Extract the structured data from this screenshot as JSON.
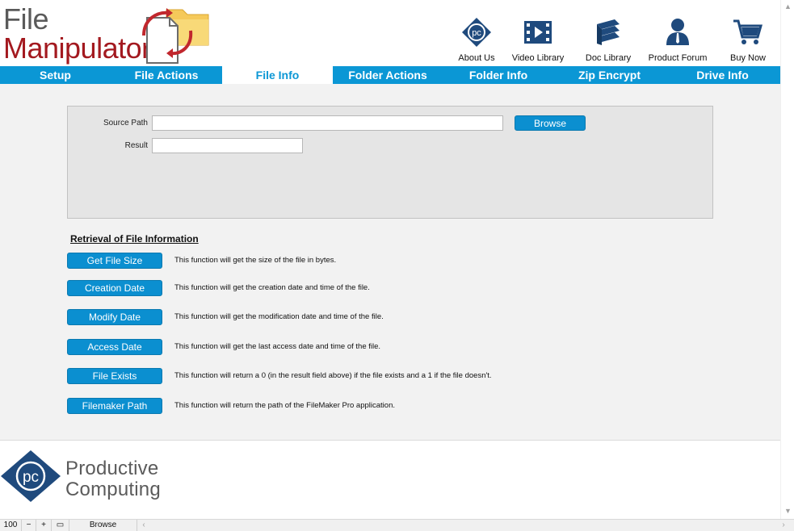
{
  "header": {
    "logo_line1": "File",
    "logo_line2": "Manipulator"
  },
  "topnav": [
    {
      "label": "About Us",
      "icon": "pc-logo-icon"
    },
    {
      "label": "Video Library",
      "icon": "film-icon"
    },
    {
      "label": "Doc Library",
      "icon": "books-icon"
    },
    {
      "label": "Product Forum",
      "icon": "person-icon"
    },
    {
      "label": "Buy Now",
      "icon": "cart-icon"
    }
  ],
  "tabs": [
    {
      "label": "Setup",
      "active": false
    },
    {
      "label": "File Actions",
      "active": false
    },
    {
      "label": "File Info",
      "active": true
    },
    {
      "label": "Folder Actions",
      "active": false
    },
    {
      "label": "Folder Info",
      "active": false
    },
    {
      "label": "Zip Encrypt",
      "active": false
    },
    {
      "label": "Drive Info",
      "active": false
    }
  ],
  "form": {
    "source_path_label": "Source Path",
    "source_path_value": "",
    "browse_label": "Browse",
    "result_label": "Result",
    "result_value": ""
  },
  "section_title": "Retrieval of File Information",
  "functions": [
    {
      "button": "Get File Size",
      "desc": "This function will get the size of the file in bytes."
    },
    {
      "button": "Creation Date",
      "desc": "This function will get the creation date and time of the file."
    },
    {
      "button": "Modify Date",
      "desc": "This function will get the modification date and time of the file."
    },
    {
      "button": "Access Date",
      "desc": "This function will get the last access date and time of the file."
    },
    {
      "button": "File Exists",
      "desc": "This function will return a 0 (in the result field above) if the file exists and a 1 if the file doesn't."
    },
    {
      "button": "Filemaker Path",
      "desc": "This function will return the path of the FileMaker Pro application."
    }
  ],
  "footer_logo": {
    "line1": "Productive",
    "line2": "Computing"
  },
  "statusbar": {
    "zoom": "100",
    "mode": "Browse"
  },
  "colors": {
    "accent": "#0b97d5",
    "logo_red": "#a3191f",
    "nav_icon": "#1f4a7d"
  }
}
